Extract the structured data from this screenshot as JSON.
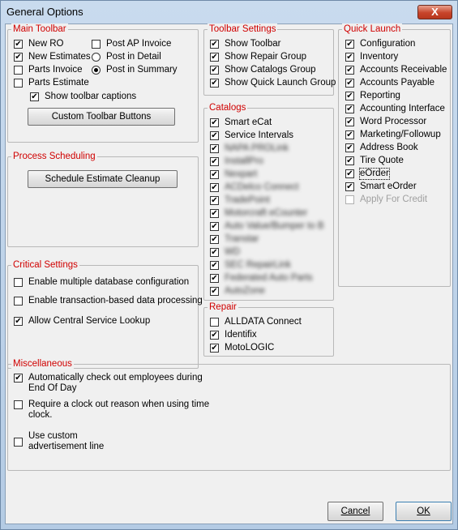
{
  "window": {
    "title": "General Options",
    "close_label": "X"
  },
  "main_toolbar": {
    "legend": "Main Toolbar",
    "new_ro": "New RO",
    "post_ap_invoice": "Post AP Invoice",
    "new_estimates": "New Estimates",
    "post_in_detail": "Post in Detail",
    "parts_invoice": "Parts Invoice",
    "post_in_summary": "Post in Summary",
    "parts_estimate": "Parts Estimate",
    "show_toolbar_captions": "Show toolbar captions",
    "custom_toolbar_buttons": "Custom Toolbar Buttons"
  },
  "toolbar_settings": {
    "legend": "Toolbar Settings",
    "items": [
      "Show Toolbar",
      "Show Repair Group",
      "Show Catalogs Group",
      "Show Quick Launch Group"
    ]
  },
  "quick_launch": {
    "legend": "Quick Launch",
    "items": [
      "Configuration",
      "Inventory",
      "Accounts Receivable",
      "Accounts Payable",
      "Reporting",
      "Accounting Interface",
      "Word Processor",
      "Marketing/Followup",
      "Address Book",
      "Tire Quote",
      "eOrder",
      "Smart eOrder",
      "Apply For Credit"
    ]
  },
  "catalogs": {
    "legend": "Catalogs",
    "items": [
      "Smart eCat",
      "Service Intervals",
      "NAPA PROLink",
      "InstallPro",
      "Nexpart",
      "ACDelco Connect",
      "TradePoint",
      "Motorcraft eCounter",
      "Auto Value/Bumper to B",
      "Transtar",
      "WD",
      "SEC RepairLink",
      "Federated Auto Parts",
      "AutoZone"
    ]
  },
  "repair": {
    "legend": "Repair",
    "items": [
      "ALLDATA Connect",
      "Identifix",
      "MotoLOGIC"
    ]
  },
  "process_scheduling": {
    "legend": "Process Scheduling",
    "schedule_cleanup": "Schedule Estimate Cleanup"
  },
  "critical_settings": {
    "legend": "Critical Settings",
    "items": [
      "Enable multiple database configuration",
      "Enable transaction-based data processing",
      "Allow Central Service Lookup"
    ]
  },
  "miscellaneous": {
    "legend": "Miscellaneous",
    "auto_checkout_1": "Automatically check out employees during",
    "auto_checkout_2": "End Of Day",
    "clock_reason_1": "Require a clock out reason when using time",
    "clock_reason_2": "clock.",
    "custom_ad_1": "Use custom",
    "custom_ad_2": "advertisement line"
  },
  "buttons": {
    "cancel": "Cancel",
    "ok": "OK"
  }
}
